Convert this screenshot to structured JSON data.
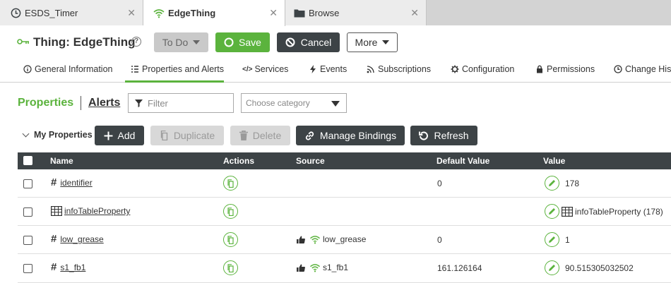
{
  "tabs": [
    {
      "label": "ESDS_Timer",
      "icon": "clock-icon"
    },
    {
      "label": "EdgeThing",
      "icon": "wifi-icon"
    },
    {
      "label": "Browse",
      "icon": "folder-icon"
    }
  ],
  "header": {
    "title": "Thing: EdgeThing",
    "todo_label": "To Do",
    "save_label": "Save",
    "cancel_label": "Cancel",
    "more_label": "More"
  },
  "nav": [
    {
      "label": "General Information",
      "icon": "info-icon"
    },
    {
      "label": "Properties and Alerts",
      "icon": "list-icon",
      "active": true
    },
    {
      "label": "Services",
      "icon": "code-icon"
    },
    {
      "label": "Events",
      "icon": "lightning-icon"
    },
    {
      "label": "Subscriptions",
      "icon": "rss-icon"
    },
    {
      "label": "Configuration",
      "icon": "gear-icon"
    },
    {
      "label": "Permissions",
      "icon": "lock-icon"
    },
    {
      "label": "Change History",
      "icon": "history-icon"
    }
  ],
  "section": {
    "properties_label": "Properties",
    "alerts_label": "Alerts",
    "filter_placeholder": "Filter",
    "category_placeholder": "Choose category"
  },
  "toolbar": {
    "my_properties": "My Properties",
    "add": "Add",
    "duplicate": "Duplicate",
    "delete": "Delete",
    "manage_bindings": "Manage Bindings",
    "refresh": "Refresh"
  },
  "table": {
    "columns": [
      "Name",
      "Actions",
      "Source",
      "Default Value",
      "Value"
    ],
    "rows": [
      {
        "name": "identifier",
        "type": "number",
        "source": "",
        "default": "0",
        "value": "178"
      },
      {
        "name": "infoTableProperty",
        "type": "infotable",
        "source": "",
        "default": "",
        "value": "infoTableProperty (178)"
      },
      {
        "name": "low_grease",
        "type": "number",
        "source": "low_grease",
        "default": "0",
        "value": "1"
      },
      {
        "name": "s1_fb1",
        "type": "number",
        "source": "s1_fb1",
        "default": "161.126164",
        "value": "90.515305032502"
      }
    ]
  },
  "colors": {
    "accent": "#5bb33d",
    "dark": "#3d4346"
  }
}
